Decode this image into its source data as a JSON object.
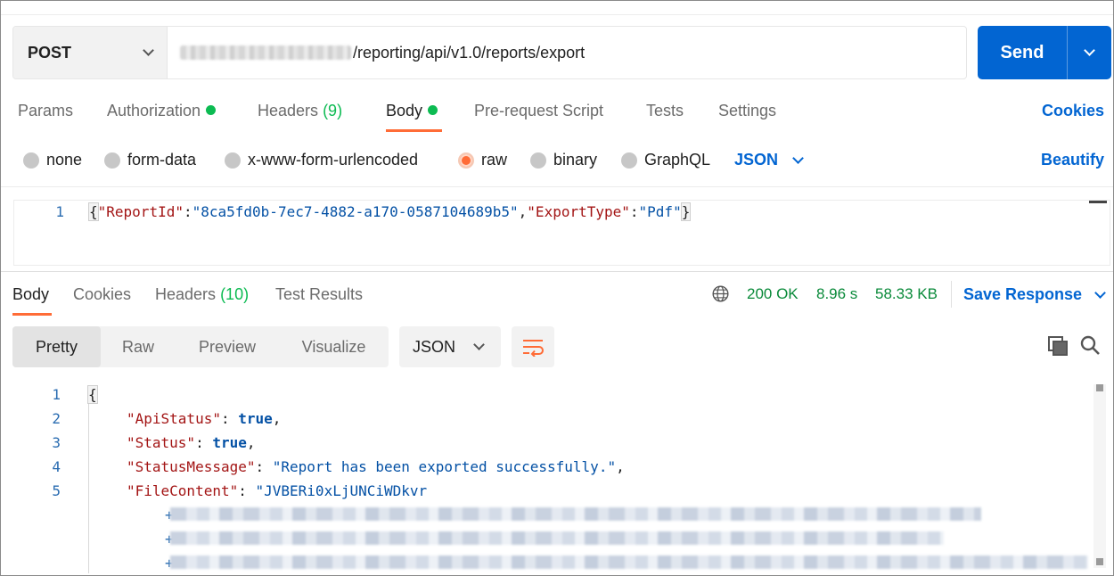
{
  "request": {
    "method": "POST",
    "url_path": "/reporting/api/v1.0/reports/export",
    "send_label": "Send"
  },
  "request_tabs": {
    "params": "Params",
    "authorization": "Authorization",
    "headers": "Headers",
    "headers_count": "(9)",
    "body": "Body",
    "pre_request": "Pre-request Script",
    "tests": "Tests",
    "settings": "Settings",
    "cookies": "Cookies"
  },
  "body_types": {
    "none": "none",
    "form_data": "form-data",
    "urlencoded": "x-www-form-urlencoded",
    "raw": "raw",
    "binary": "binary",
    "graphql": "GraphQL",
    "format": "JSON",
    "beautify": "Beautify",
    "selected": "raw"
  },
  "request_body": {
    "line_number": "1",
    "open": "{",
    "key1": "\"ReportId\"",
    "colon": ":",
    "val1": "\"8ca5fd0b-7ec7-4882-a170-0587104689b5\"",
    "comma": ",",
    "key2": "\"ExportType\"",
    "val2": "\"Pdf\"",
    "close": "}"
  },
  "response_tabs": {
    "body": "Body",
    "cookies": "Cookies",
    "headers": "Headers",
    "headers_count": "(10)",
    "test_results": "Test Results"
  },
  "response_meta": {
    "status": "200 OK",
    "time": "8.96 s",
    "size": "58.33 KB",
    "save": "Save Response"
  },
  "view_tabs": {
    "pretty": "Pretty",
    "raw": "Raw",
    "preview": "Preview",
    "visualize": "Visualize",
    "format": "JSON"
  },
  "response_body": {
    "ln1": "1",
    "ln2": "2",
    "ln3": "3",
    "ln4": "4",
    "ln5": "5",
    "open": "{",
    "k_api": "\"ApiStatus\"",
    "v_api": "true",
    "k_status": "\"Status\"",
    "v_status": "true",
    "k_msg": "\"StatusMessage\"",
    "v_msg": "\"Report has been exported successfully.\"",
    "k_file": "\"FileContent\"",
    "v_file": "\"JVBERi0xLjUNCiWDkvr",
    "plus": "+"
  },
  "colors": {
    "accent": "#0265d2",
    "tab_indicator": "#ff6c37",
    "success": "#0cbb52"
  }
}
